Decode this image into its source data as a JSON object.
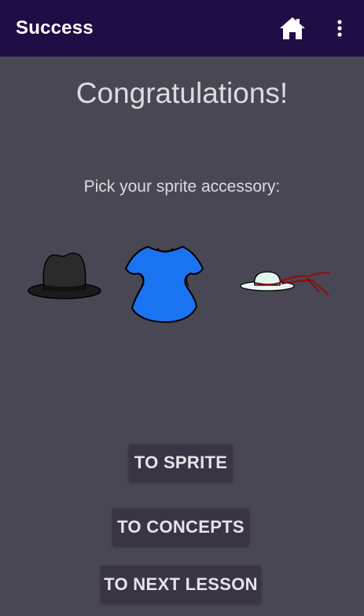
{
  "appbar": {
    "title": "Success",
    "home_icon": "home-icon",
    "overflow_icon": "more-vert-icon",
    "background": "#1f0d45"
  },
  "main": {
    "headline": "Congratulations!",
    "prompt": "Pick your sprite accessory:",
    "accessories": [
      {
        "name": "black-fedora-hat-icon"
      },
      {
        "name": "blue-dress-icon"
      },
      {
        "name": "white-sun-hat-icon"
      }
    ],
    "buttons": {
      "to_sprite": "TO SPRITE",
      "to_concepts": "TO CONCEPTS",
      "to_next_lesson": "TO NEXT LESSON"
    }
  },
  "colors": {
    "background": "#4a4754",
    "button_bg": "#3a3445",
    "text": "#dcdbe0",
    "dress_blue": "#1a73f0"
  }
}
